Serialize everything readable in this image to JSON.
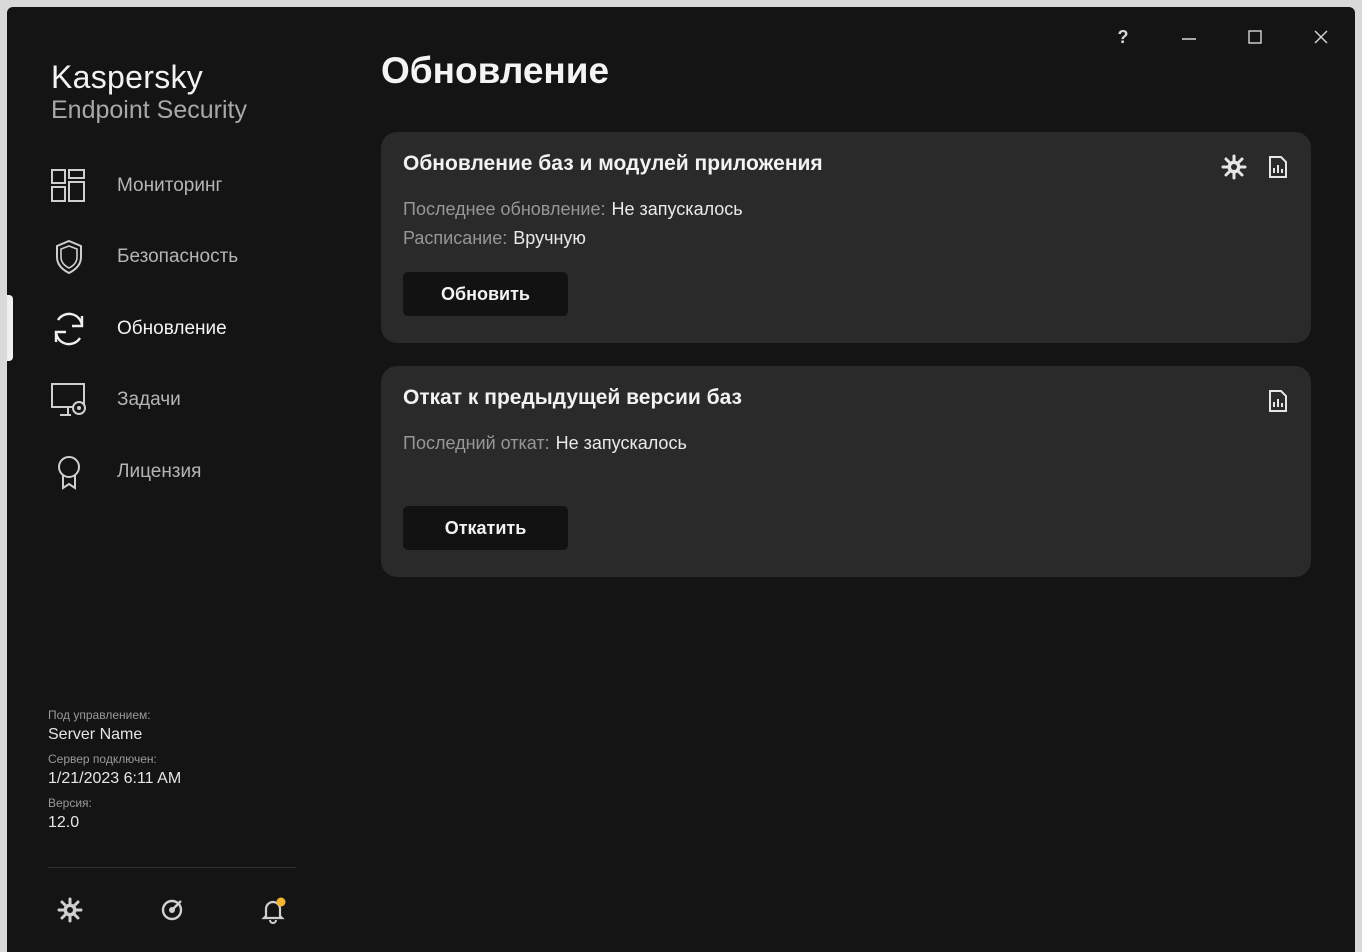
{
  "window": {
    "help_label": "?",
    "app_name": "Kaspersky",
    "product_name": "Endpoint Security"
  },
  "sidebar": {
    "items": [
      {
        "label": "Мониторинг",
        "icon": "dashboard-icon"
      },
      {
        "label": "Безопасность",
        "icon": "shield-icon"
      },
      {
        "label": "Обновление",
        "icon": "refresh-icon",
        "active": true
      },
      {
        "label": "Задачи",
        "icon": "monitor-gear-icon"
      },
      {
        "label": "Лицензия",
        "icon": "award-icon"
      }
    ],
    "managed_caption": "Под управлением:",
    "managed_value": "Server Name",
    "connected_caption": "Сервер подключен:",
    "connected_value": "1/21/2023 6:11 AM",
    "version_caption": "Версия:",
    "version_value": "12.0",
    "bottom_icons": [
      "settings-icon",
      "support-icon",
      "notifications-icon"
    ],
    "notification_dot_color": "#f2b632"
  },
  "main": {
    "title": "Обновление",
    "cards": [
      {
        "title": "Обновление баз и модулей приложения",
        "rows": [
          {
            "key": "Последнее обновление:",
            "value": "Не запускалось"
          },
          {
            "key": "Расписание:",
            "value": "Вручную"
          }
        ],
        "button": "Обновить"
      },
      {
        "title": "Откат к предыдущей версии баз",
        "rows": [
          {
            "key": "Последний откат:",
            "value": "Не запускалось"
          }
        ],
        "button": "Откатить"
      }
    ]
  },
  "colors": {
    "background": "#141414",
    "card": "#2a2a2a",
    "button": "#121212"
  }
}
